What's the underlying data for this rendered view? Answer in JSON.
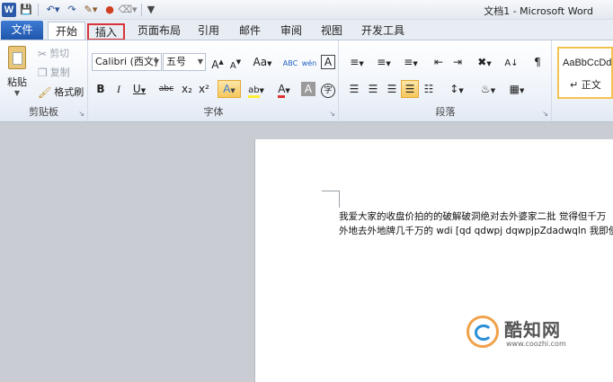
{
  "titlebar": {
    "app_title": "文档1 - Microsoft Word",
    "word_logo": "W"
  },
  "tabs": {
    "file": "文件",
    "items": [
      "开始",
      "插入",
      "页面布局",
      "引用",
      "邮件",
      "审阅",
      "视图",
      "开发工具"
    ],
    "active": "开始",
    "highlighted": "插入",
    "highlight_color": "#d8343a"
  },
  "clipboard": {
    "paste": "粘贴",
    "cut": "剪切",
    "copy": "复制",
    "format_painter": "格式刷",
    "group_label": "剪贴板"
  },
  "font": {
    "font_name": "Calibri (西文]",
    "font_size": "五号",
    "grow": "A",
    "shrink": "A",
    "change_case": "Aa",
    "clear": "ABC",
    "phonetic": "wén",
    "border_char": "A",
    "bold": "B",
    "italic": "I",
    "underline": "U",
    "strike": "abc",
    "subscript": "x₂",
    "superscript": "x²",
    "text_effect": "A",
    "highlight": "ab",
    "font_color": "A",
    "char_shading": "A",
    "enclose": "字",
    "group_label": "字体"
  },
  "paragraph": {
    "group_label": "段落"
  },
  "styles": {
    "sample": "AaBbCcDd",
    "normal": "↵ 正文"
  },
  "document": {
    "line1": "我爱大家的收盘价拍的的破解破洞绝对去外婆家二批  觉得但千万",
    "line2": "外地去外地牌几千万的 wdi [qd qdwpj dqwpjpZdadwqln 我即使是"
  },
  "watermark": {
    "title": "酷知网",
    "url": "www.coozhi.com"
  },
  "colors": {
    "file_tab": "#2a63b8",
    "accent_yellow": "#f3c34f",
    "font_color_red": "#e03030",
    "highlight_yellow": "#ffee33"
  }
}
